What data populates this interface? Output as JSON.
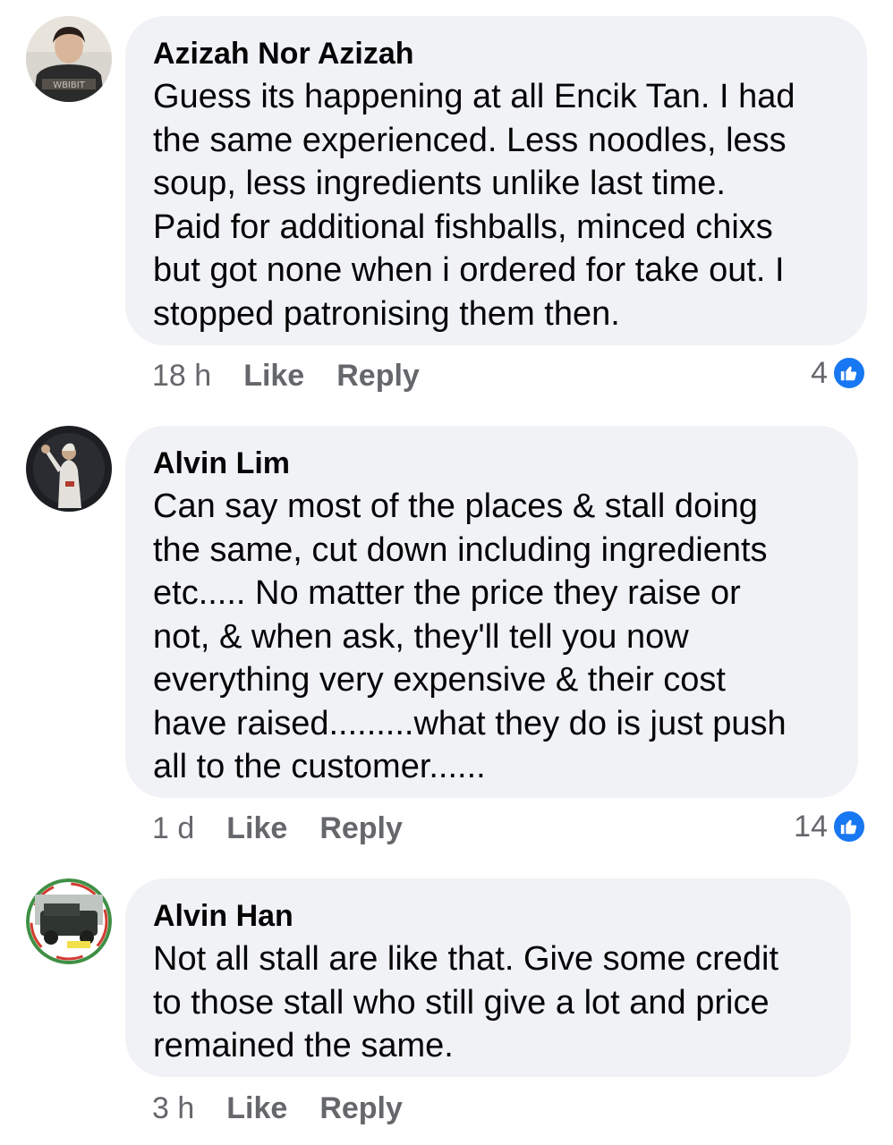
{
  "comments": [
    {
      "author": "Azizah Nor Azizah",
      "text": "Guess its happening at all Encik Tan. I had\nthe same experienced. Less noodles, less\nsoup, less ingredients unlike last time.\nPaid for additional fishballs, minced chixs\nbut got none when i ordered for take out. I\nstopped patronising them then.",
      "time": "18 h",
      "like_label": "Like",
      "reply_label": "Reply",
      "reaction_count": "4",
      "reaction_icon": "thumbs-up-icon",
      "avatar_icon": "user-avatar"
    },
    {
      "author": "Alvin Lim",
      "text": "Can say most of the places & stall doing\nthe same, cut down including ingredients\netc..... No matter the price they raise or\nnot, & when ask, they'll tell you now\neverything very expensive & their cost\nhave raised.........what they do is just push\nall to the customer......",
      "time": "1 d",
      "like_label": "Like",
      "reply_label": "Reply",
      "reaction_count": "14",
      "reaction_icon": "thumbs-up-icon",
      "avatar_icon": "user-avatar"
    },
    {
      "author": "Alvin Han",
      "text": "Not all stall are like that. Give some credit\nto those stall who still give a lot and price\nremained the same.",
      "time": "3 h",
      "like_label": "Like",
      "reply_label": "Reply",
      "avatar_icon": "user-avatar"
    }
  ],
  "colors": {
    "bubble": "#f0f2f5",
    "text": "#050505",
    "meta": "#65676b",
    "like_blue": "#1877f2"
  }
}
